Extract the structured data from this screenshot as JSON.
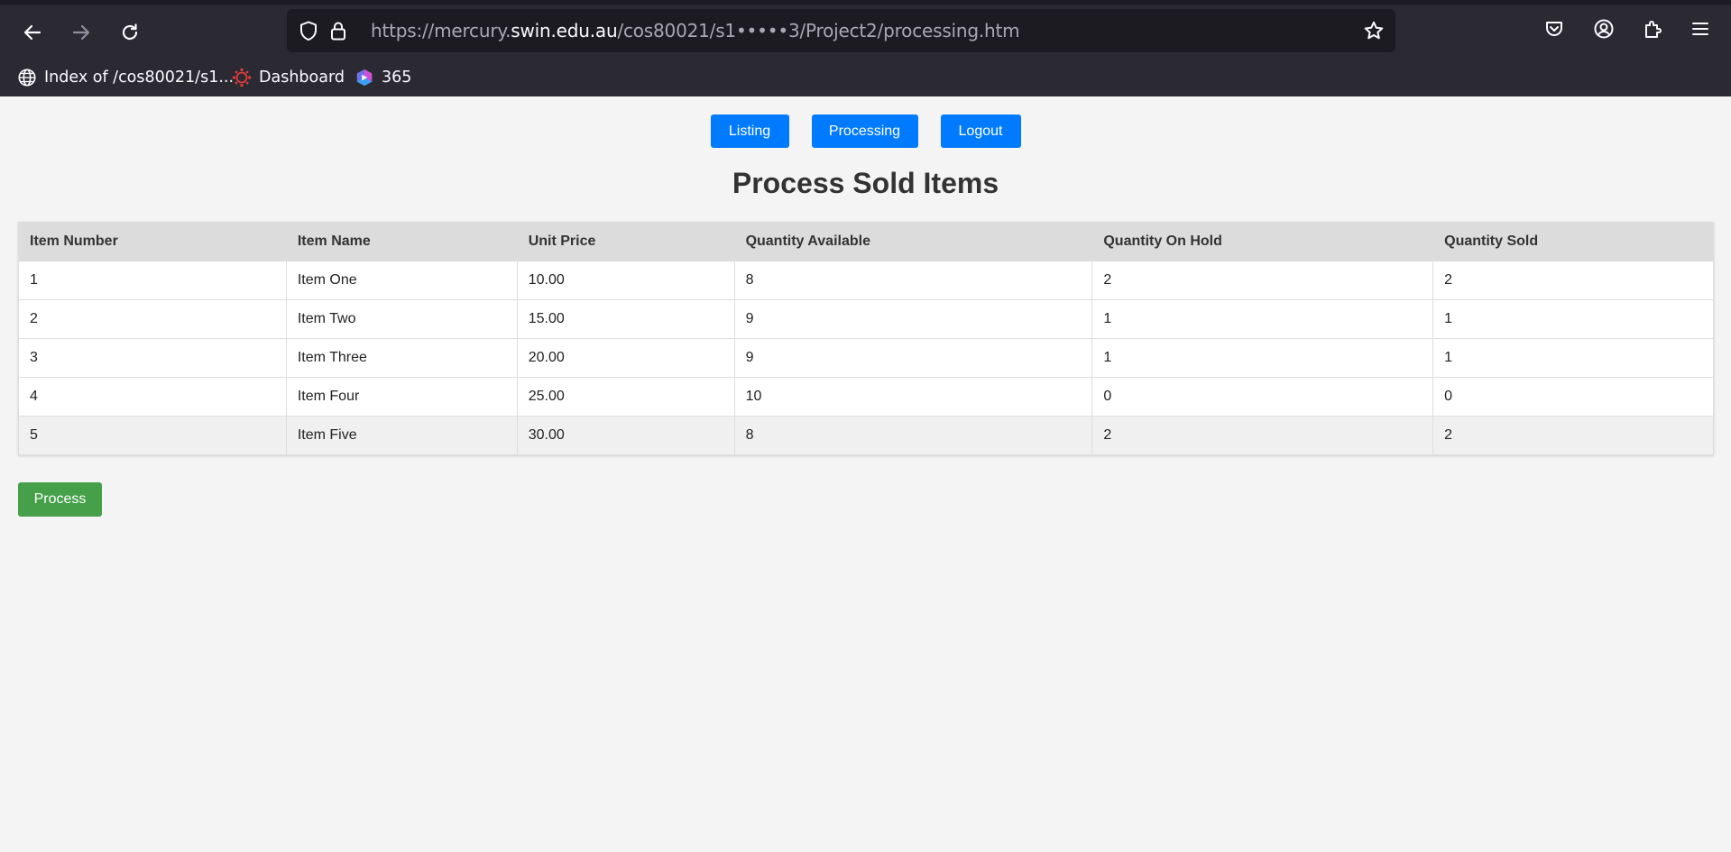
{
  "browser": {
    "url": {
      "prefix": "https://mercury.",
      "domain": "swin.edu.au",
      "path": "/cos80021/s1",
      "redacted": "•••••",
      "suffix": "3/Project2/processing.htm"
    },
    "bookmarks": [
      {
        "label": "Index of /cos80021/s1...",
        "icon": "globe-icon"
      },
      {
        "label": "Dashboard",
        "icon": "canvas-logo-icon"
      },
      {
        "label": "365",
        "icon": "microsoft-365-icon"
      }
    ]
  },
  "nav": {
    "listing": "Listing",
    "processing": "Processing",
    "logout": "Logout"
  },
  "page": {
    "title": "Process Sold Items",
    "process_button": "Process"
  },
  "table": {
    "headers": [
      "Item Number",
      "Item Name",
      "Unit Price",
      "Quantity Available",
      "Quantity On Hold",
      "Quantity Sold"
    ],
    "rows": [
      [
        "1",
        "Item One",
        "10.00",
        "8",
        "2",
        "2"
      ],
      [
        "2",
        "Item Two",
        "15.00",
        "9",
        "1",
        "1"
      ],
      [
        "3",
        "Item Three",
        "20.00",
        "9",
        "1",
        "1"
      ],
      [
        "4",
        "Item Four",
        "25.00",
        "10",
        "0",
        "0"
      ],
      [
        "5",
        "Item Five",
        "30.00",
        "8",
        "2",
        "2"
      ]
    ]
  },
  "colors": {
    "nav_button": "#007bff",
    "process_button": "#45a049",
    "chrome_bg": "#2b2a33"
  }
}
